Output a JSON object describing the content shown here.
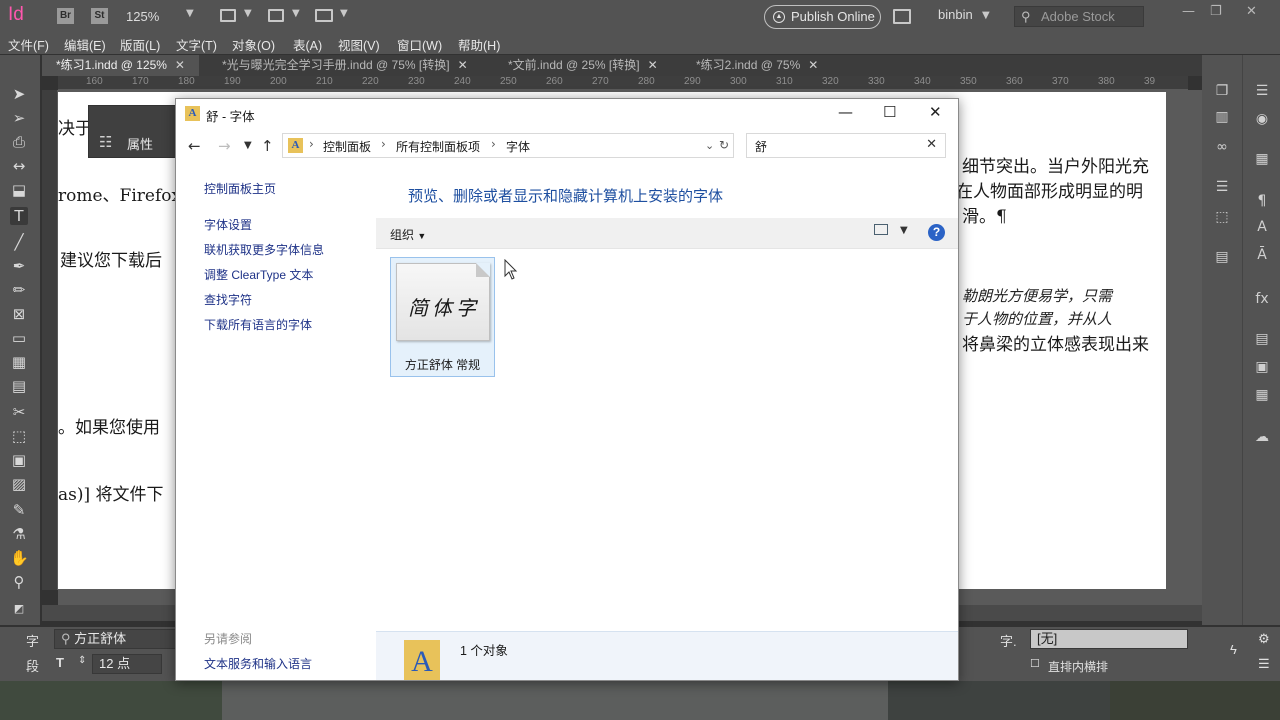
{
  "app": {
    "logo": "Id",
    "bridge_label": "Br",
    "stock_label": "St",
    "zoom": "125%",
    "publish_label": "Publish Online",
    "user": "binbin",
    "stock_search_placeholder": "Adobe Stock"
  },
  "menubar": {
    "items": [
      "文件(F)",
      "编辑(E)",
      "版面(L)",
      "文字(T)",
      "对象(O)",
      "表(A)",
      "视图(V)",
      "窗口(W)",
      "帮助(H)"
    ]
  },
  "doc_tabs": [
    {
      "label": "*练习1.indd @ 125%",
      "active": true
    },
    {
      "label": "*光与曝光完全学习手册.indd @ 75% [转换]",
      "active": false
    },
    {
      "label": "*文前.indd @ 25% [转换]",
      "active": false
    },
    {
      "label": "*练习2.indd @ 75%",
      "active": false
    }
  ],
  "ruler_numbers": [
    "160",
    "170",
    "180",
    "190",
    "200",
    "210",
    "220",
    "230",
    "240",
    "250",
    "260",
    "270",
    "280",
    "290",
    "300",
    "310",
    "320",
    "330",
    "340",
    "350",
    "360",
    "370",
    "380",
    "39"
  ],
  "properties_panel": {
    "title": "属性"
  },
  "page_text": {
    "left": [
      "决于",
      "rome、Firefox",
      "建议您下载后",
      "。如果您使用",
      "as)] 将文件下"
    ],
    "right": [
      "细节突出。当户外阳光充",
      "在人物面部形成明显的明",
      "滑。¶",
      "勒朗光方便易学，只需",
      "于人物的位置，并从人",
      "将鼻梁的立体感表现出来"
    ]
  },
  "control_panel": {
    "char_label": "字",
    "para_label": "段",
    "font_value": "方正舒体",
    "size_value": "12 点",
    "style_label": "字.",
    "style_value": "[无]",
    "tate_label": "直排内横排"
  },
  "explorer": {
    "title": "舒 - 字体",
    "breadcrumbs": [
      "控制面板",
      "所有控制面板项",
      "字体"
    ],
    "search_value": "舒",
    "left_links": [
      "控制面板主页",
      "字体设置",
      "联机获取更多字体信息",
      "调整 ClearType 文本",
      "查找字符",
      "下载所有语言的字体"
    ],
    "see_also_label": "另请参阅",
    "see_also_link": "文本服务和输入语言",
    "heading": "预览、删除或者显示和隐藏计算机上安装的字体",
    "organize_label": "组织",
    "font_tile": {
      "sample": "简体字",
      "name": "方正舒体 常规"
    },
    "status": "1 个对象"
  }
}
